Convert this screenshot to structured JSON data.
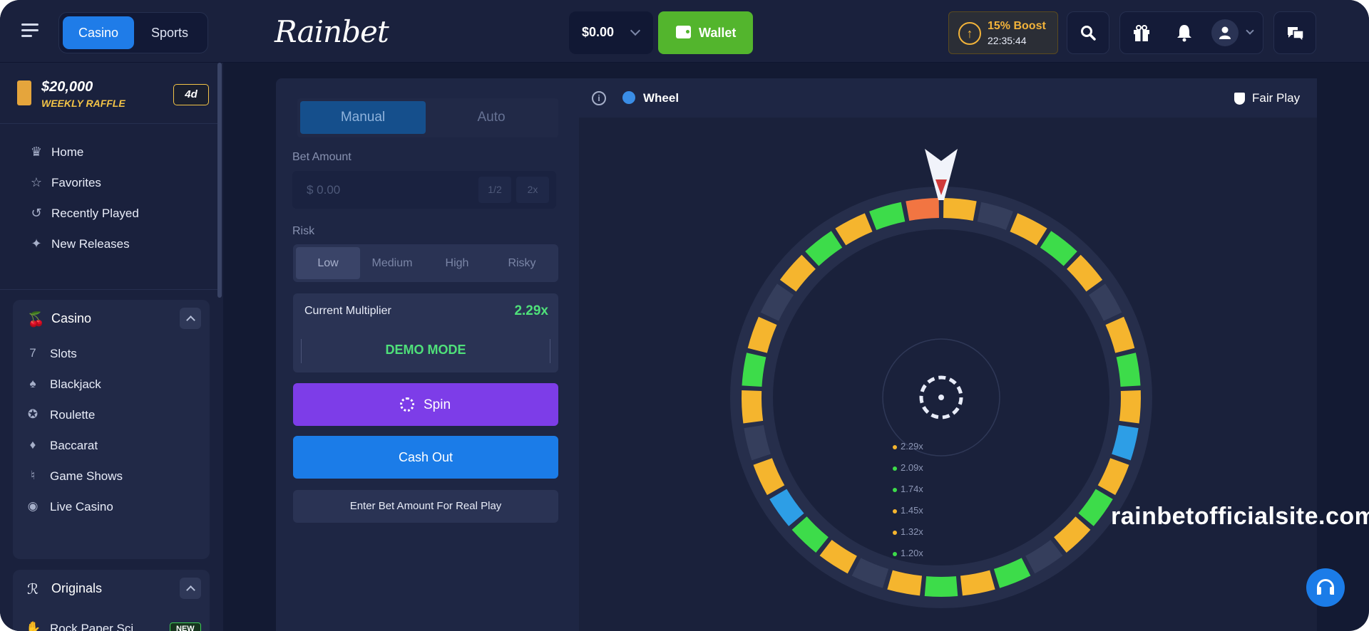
{
  "header": {
    "tabs": [
      {
        "label": "Casino",
        "active": true
      },
      {
        "label": "Sports",
        "active": false
      }
    ],
    "logo": "Rainbet",
    "balance": "$0.00",
    "wallet_label": "Wallet",
    "boost_title": "15% Boost",
    "boost_timer": "22:35:44",
    "icons": [
      "menu-icon",
      "search-icon",
      "gift-icon",
      "bell-icon",
      "user-icon",
      "chat-icon"
    ]
  },
  "sidebar": {
    "raffle_amount": "$20,000",
    "raffle_label": "WEEKLY RAFFLE",
    "raffle_days": "4d",
    "nav": [
      {
        "label": "Home",
        "icon": "crown-icon"
      },
      {
        "label": "Favorites",
        "icon": "star-icon"
      },
      {
        "label": "Recently Played",
        "icon": "history-icon"
      },
      {
        "label": "New Releases",
        "icon": "sparkle-icon"
      }
    ],
    "casino": {
      "label": "Casino",
      "items": [
        {
          "label": "Slots",
          "icon": "seven-icon"
        },
        {
          "label": "Blackjack",
          "icon": "spade-icon"
        },
        {
          "label": "Roulette",
          "icon": "roulette-icon"
        },
        {
          "label": "Baccarat",
          "icon": "cards-icon"
        },
        {
          "label": "Game Shows",
          "icon": "mic-icon"
        },
        {
          "label": "Live Casino",
          "icon": "broadcast-icon"
        }
      ]
    },
    "originals": {
      "label": "Originals",
      "items": [
        {
          "label": "Rock Paper Sci",
          "badge": "NEW"
        }
      ]
    }
  },
  "bet_panel": {
    "modes": [
      {
        "label": "Manual",
        "active": true
      },
      {
        "label": "Auto",
        "active": false
      }
    ],
    "bet_amount_label": "Bet Amount",
    "bet_placeholder": "$ 0.00",
    "half_label": "1/2",
    "double_label": "2x",
    "risk_label": "Risk",
    "risks": [
      {
        "label": "Low",
        "active": true
      },
      {
        "label": "Medium"
      },
      {
        "label": "High"
      },
      {
        "label": "Risky"
      }
    ],
    "current_multiplier_label": "Current Multiplier",
    "current_multiplier": "2.29x",
    "demo_mode": "DEMO MODE",
    "spin_label": "Spin",
    "cashout_label": "Cash Out",
    "real_play_note": "Enter Bet Amount For Real Play"
  },
  "game": {
    "title": "Wheel",
    "fair_play": "Fair Play",
    "multipliers": [
      {
        "value": "2.29x",
        "color": "#f5b52e"
      },
      {
        "value": "2.09x",
        "color": "#3ddc4a"
      },
      {
        "value": "1.74x",
        "color": "#3ddc4a"
      },
      {
        "value": "1.45x",
        "color": "#f5b52e"
      },
      {
        "value": "1.32x",
        "color": "#f5b52e"
      },
      {
        "value": "1.20x",
        "color": "#3ddc4a"
      }
    ],
    "segments": [
      "#f5b52e",
      "#353e5c",
      "#f5b52e",
      "#3ddc4a",
      "#f5b52e",
      "#353e5c",
      "#f5b52e",
      "#3ddc4a",
      "#f5b52e",
      "#2d9ee6",
      "#f5b52e",
      "#3ddc4a",
      "#f5b52e",
      "#353e5c",
      "#3ddc4a",
      "#f5b52e",
      "#3ddc4a",
      "#f5b52e",
      "#353e5c",
      "#f5b52e",
      "#3ddc4a",
      "#2d9ee6",
      "#f5b52e",
      "#353e5c",
      "#f5b52e",
      "#3ddc4a",
      "#f5b52e",
      "#353e5c",
      "#f5b52e",
      "#3ddc4a",
      "#f5b52e",
      "#3ddc4a",
      "#f27542"
    ]
  },
  "watermark": "rainbetofficialsite.com",
  "colors": {
    "accent_blue": "#1b7ce8",
    "wallet_green": "#53b52d",
    "spin_purple": "#7d3de8",
    "win_green": "#4fe07a"
  }
}
